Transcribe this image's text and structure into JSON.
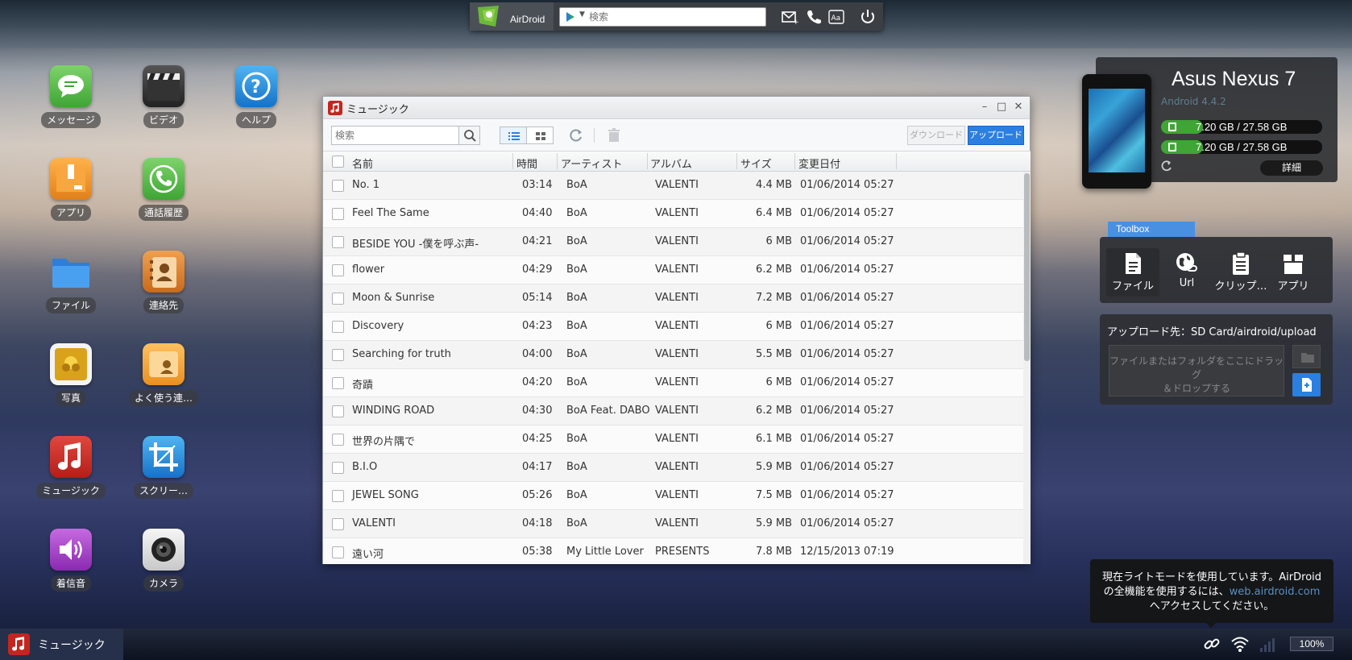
{
  "topbar": {
    "brand": "AirDroid",
    "search_placeholder": "検索"
  },
  "desktop": {
    "icons": [
      {
        "label": "メッセージ",
        "icon": "message-icon",
        "color": "#4cb848"
      },
      {
        "label": "ビデオ",
        "icon": "clapperboard-icon",
        "color": "#333333"
      },
      {
        "label": "ヘルプ",
        "icon": "help-icon",
        "color": "#1e88d8"
      },
      {
        "label": "アプリ",
        "icon": "app-box-icon",
        "color": "#f0902a"
      },
      {
        "label": "通話履歴",
        "icon": "phone-icon",
        "color": "#4cb848"
      },
      {
        "label": "ファイル",
        "icon": "folder-icon",
        "color": "#3b8fe0"
      },
      {
        "label": "連絡先",
        "icon": "contacts-icon",
        "color": "#e07a20"
      },
      {
        "label": "写真",
        "icon": "photo-icon",
        "color": "#e0b020"
      },
      {
        "label": "よく使う連…",
        "icon": "frequent-contacts-icon",
        "color": "#f0a030"
      },
      {
        "label": "ミュージック",
        "icon": "music-icon",
        "color": "#c3261f"
      },
      {
        "label": "スクリー…",
        "icon": "crop-icon",
        "color": "#1e88d8"
      },
      {
        "label": "着信音",
        "icon": "ringtone-icon",
        "color": "#a040c0"
      },
      {
        "label": "カメラ",
        "icon": "camera-icon",
        "color": "#dddddd"
      }
    ]
  },
  "music_window": {
    "title": "ミュージック",
    "search_placeholder": "検索",
    "download_label": "ダウンロード",
    "upload_label": "アップロード",
    "columns": [
      "名前",
      "時間",
      "アーティスト",
      "アルバム",
      "サイズ",
      "変更日付"
    ],
    "rows": [
      {
        "name": "No. 1",
        "time": "03:14",
        "artist": "BoA",
        "album": "VALENTI",
        "size": "4.4 MB",
        "date": "01/06/2014 05:27"
      },
      {
        "name": "Feel The Same",
        "time": "04:40",
        "artist": "BoA",
        "album": "VALENTI",
        "size": "6.4 MB",
        "date": "01/06/2014 05:27"
      },
      {
        "name": "BESIDE YOU -僕を呼ぶ声-",
        "time": "04:21",
        "artist": "BoA",
        "album": "VALENTI",
        "size": "6 MB",
        "date": "01/06/2014 05:27"
      },
      {
        "name": "flower",
        "time": "04:29",
        "artist": "BoA",
        "album": "VALENTI",
        "size": "6.2 MB",
        "date": "01/06/2014 05:27"
      },
      {
        "name": "Moon & Sunrise",
        "time": "05:14",
        "artist": "BoA",
        "album": "VALENTI",
        "size": "7.2 MB",
        "date": "01/06/2014 05:27"
      },
      {
        "name": "Discovery",
        "time": "04:23",
        "artist": "BoA",
        "album": "VALENTI",
        "size": "6 MB",
        "date": "01/06/2014 05:27"
      },
      {
        "name": "Searching for truth",
        "time": "04:00",
        "artist": "BoA",
        "album": "VALENTI",
        "size": "5.5 MB",
        "date": "01/06/2014 05:27"
      },
      {
        "name": "奇蹟",
        "time": "04:20",
        "artist": "BoA",
        "album": "VALENTI",
        "size": "6 MB",
        "date": "01/06/2014 05:27"
      },
      {
        "name": "WINDING ROAD",
        "time": "04:30",
        "artist": "BoA Feat. DABO",
        "album": "VALENTI",
        "size": "6.2 MB",
        "date": "01/06/2014 05:27"
      },
      {
        "name": "世界の片隅で",
        "time": "04:25",
        "artist": "BoA",
        "album": "VALENTI",
        "size": "6.1 MB",
        "date": "01/06/2014 05:27"
      },
      {
        "name": "B.I.O",
        "time": "04:17",
        "artist": "BoA",
        "album": "VALENTI",
        "size": "5.9 MB",
        "date": "01/06/2014 05:27"
      },
      {
        "name": "JEWEL SONG",
        "time": "05:26",
        "artist": "BoA",
        "album": "VALENTI",
        "size": "7.5 MB",
        "date": "01/06/2014 05:27"
      },
      {
        "name": "VALENTI",
        "time": "04:18",
        "artist": "BoA",
        "album": "VALENTI",
        "size": "5.9 MB",
        "date": "01/06/2014 05:27"
      },
      {
        "name": "遠い河",
        "time": "05:38",
        "artist": "My Little Lover",
        "album": "PRESENTS",
        "size": "7.8 MB",
        "date": "12/15/2013 07:19"
      }
    ]
  },
  "device": {
    "name": "Asus Nexus 7",
    "os": "Android 4.4.2",
    "storage_1": "7.20 GB / 27.58 GB",
    "storage_2": "7.20 GB / 27.58 GB",
    "storage_used_fraction": 0.26,
    "detail_label": "詳細"
  },
  "toolbox": {
    "tab_label": "Toolbox",
    "items": [
      {
        "label": "ファイル",
        "icon": "file-icon"
      },
      {
        "label": "Url",
        "icon": "globe-link-icon"
      },
      {
        "label": "クリップ…",
        "icon": "clipboard-icon"
      },
      {
        "label": "アプリ",
        "icon": "app-box-icon"
      }
    ],
    "upload_target": "アップロード先：SD Card/airdroid/upload",
    "drop_line1": "ファイルまたはフォルダをここにドラッグ",
    "drop_line2": "＆ドロップする"
  },
  "tooltip": {
    "line1": "現在ライトモードを使用しています。AirDroid",
    "line2_prefix": "の全機能を使用するには、",
    "link": "web.airdroid.com",
    "line3": "へアクセスしてください。"
  },
  "taskbar": {
    "item_label": "ミュージック",
    "battery": "100%"
  },
  "colors": {
    "accent_blue": "#2b7fe0",
    "storage_green": "#3fa535",
    "music_red": "#c3261f"
  }
}
